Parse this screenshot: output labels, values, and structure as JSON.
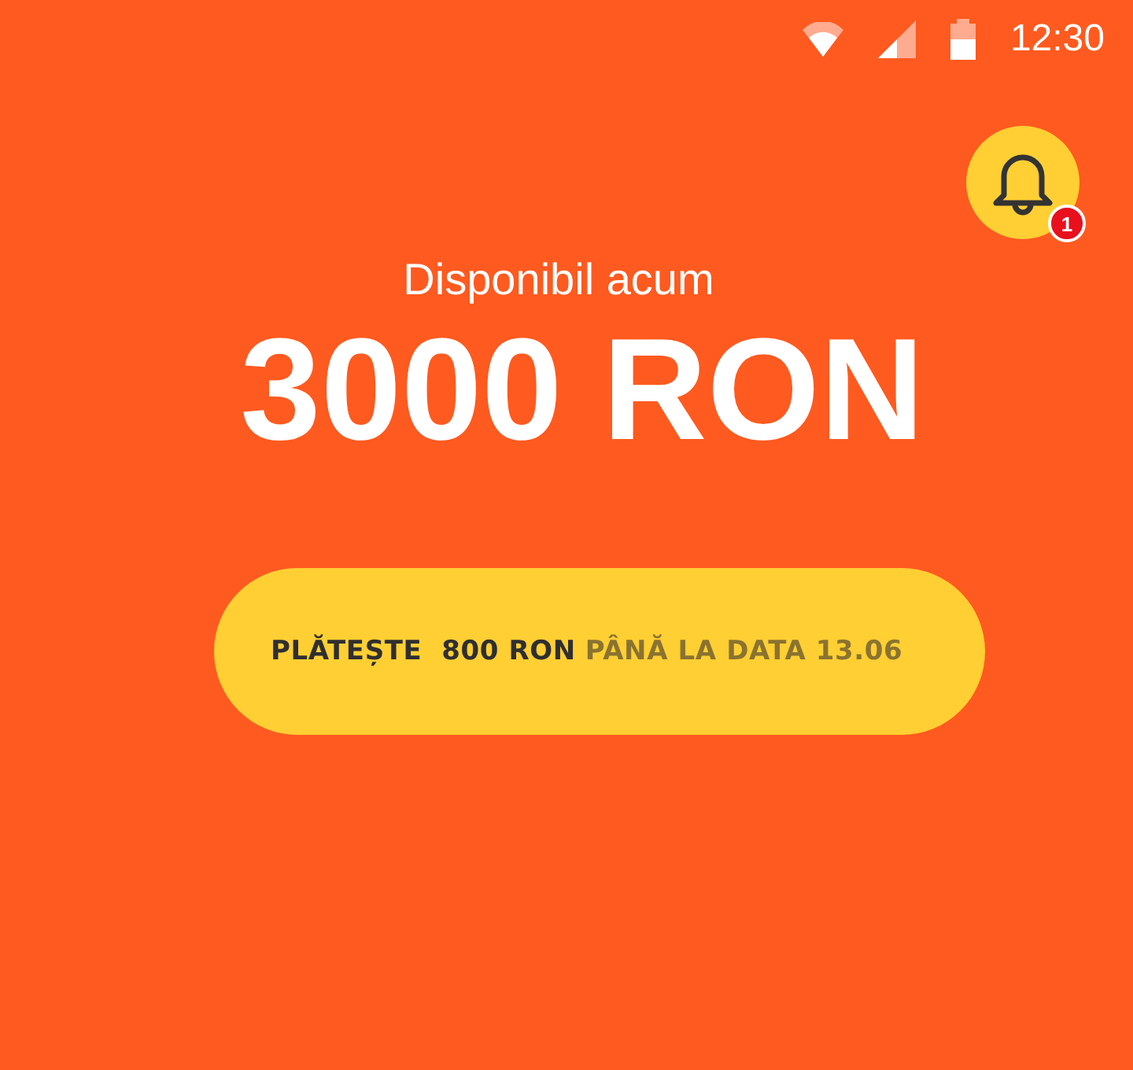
{
  "status_bar": {
    "time": "12:30"
  },
  "notifications": {
    "count": "1"
  },
  "balance": {
    "label": "Disponibil acum",
    "amount": "3000 RON"
  },
  "pay_button": {
    "action": "PLĂTEȘTE  800 RON",
    "deadline": "PÂNĂ LA DATA 13.06"
  }
}
